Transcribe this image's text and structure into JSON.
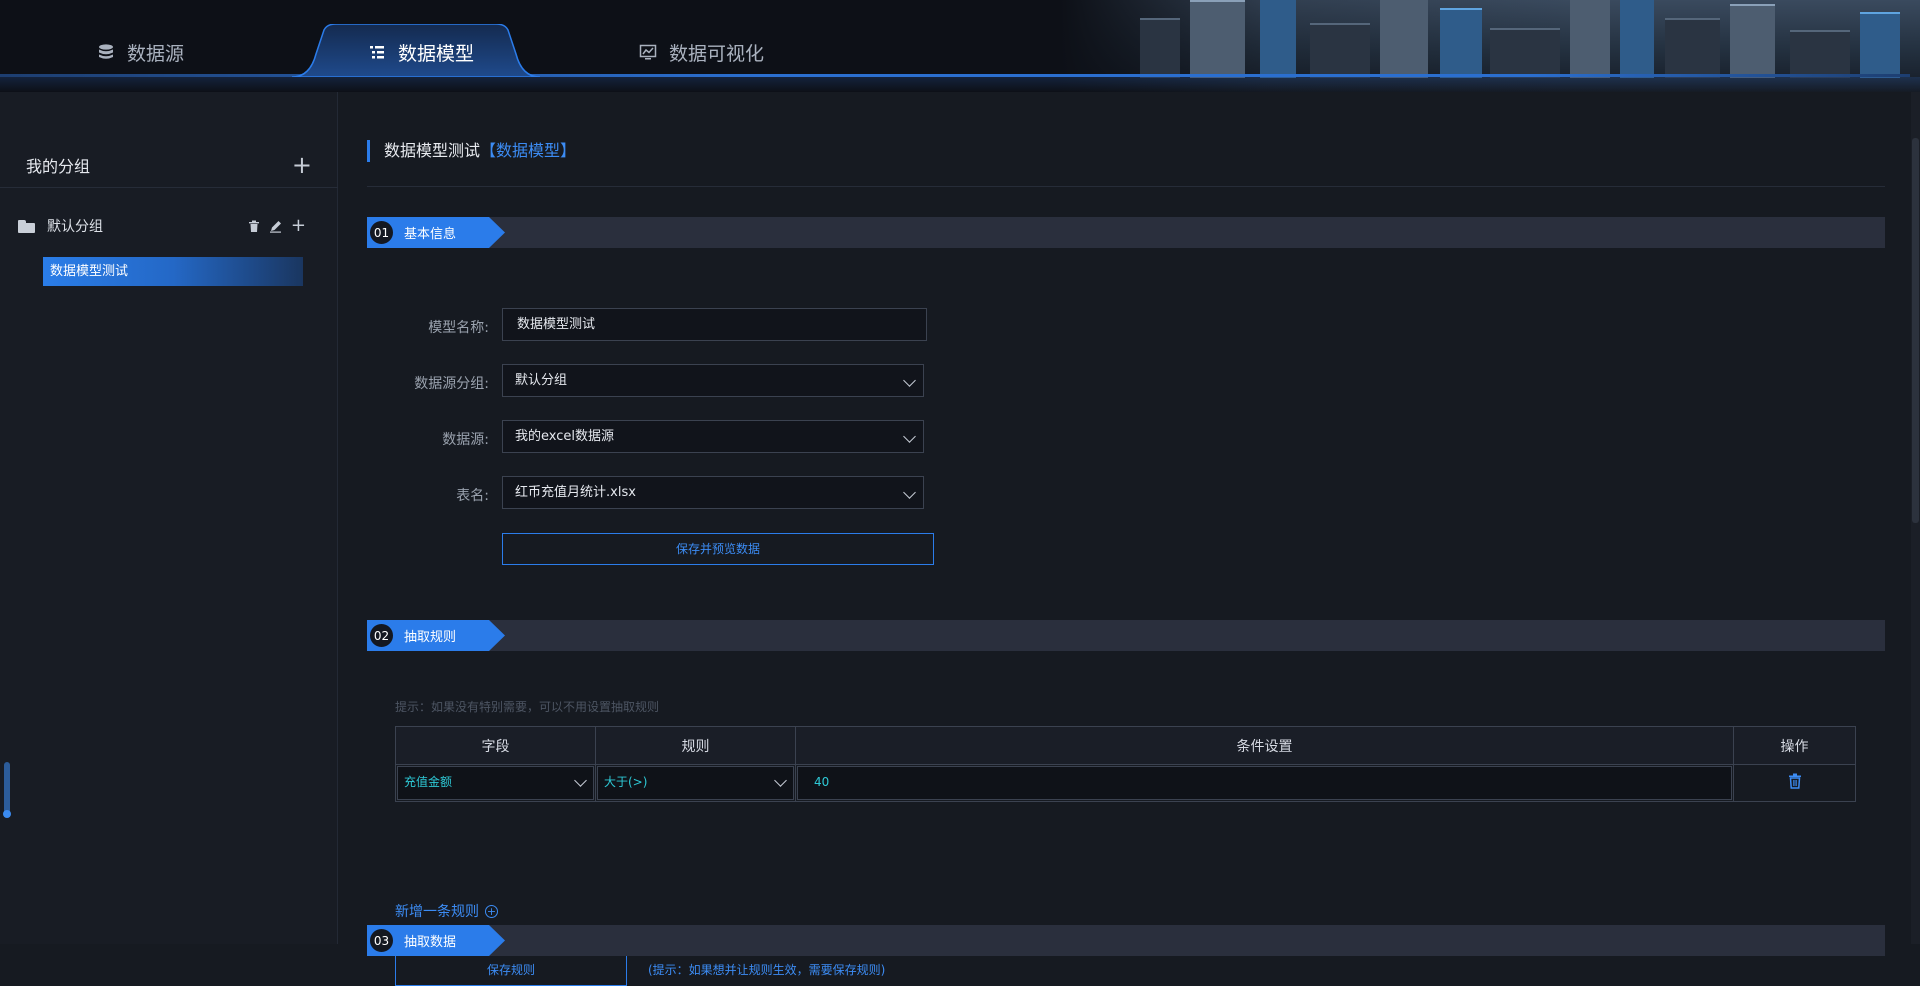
{
  "nav": {
    "tabs": [
      {
        "label": "数据源",
        "icon": "database-icon"
      },
      {
        "label": "数据模型",
        "icon": "table-list-icon",
        "active": true
      },
      {
        "label": "数据可视化",
        "icon": "chart-monitor-icon"
      }
    ]
  },
  "sidebar": {
    "title": "我的分组",
    "group": {
      "label": "默认分组"
    },
    "items": [
      {
        "label": "数据模型测试",
        "selected": true
      }
    ]
  },
  "main": {
    "breadcrumb": {
      "name": "数据模型测试",
      "type": "【数据模型】"
    },
    "section1": {
      "num": "01",
      "title": "基本信息",
      "fields": {
        "model_name": {
          "label": "模型名称:",
          "value": "数据模型测试"
        },
        "ds_group": {
          "label": "数据源分组:",
          "value": "默认分组"
        },
        "ds": {
          "label": "数据源:",
          "value": "我的excel数据源"
        },
        "table": {
          "label": "表名:",
          "value": "红币充值月统计.xlsx"
        }
      },
      "save_preview": "保存并预览数据"
    },
    "section2": {
      "num": "02",
      "title": "抽取规则",
      "hint": "提示：如果没有特别需要，可以不用设置抽取规则",
      "table": {
        "headers": [
          "字段",
          "规则",
          "条件设置",
          "操作"
        ],
        "rows": [
          {
            "field": "充值金额",
            "rule": "大于(>)",
            "condition": "40"
          }
        ]
      },
      "add_rule": "新增一条规则",
      "save_rule": "保存规则",
      "save_hint": "(提示：如果想并让规则生效，需要保存规则)"
    },
    "section3": {
      "num": "03",
      "title": "抽取数据"
    }
  },
  "colors": {
    "accent": "#2b7cea",
    "cyan_text": "#2ec9d6",
    "bg": "#161a21"
  }
}
